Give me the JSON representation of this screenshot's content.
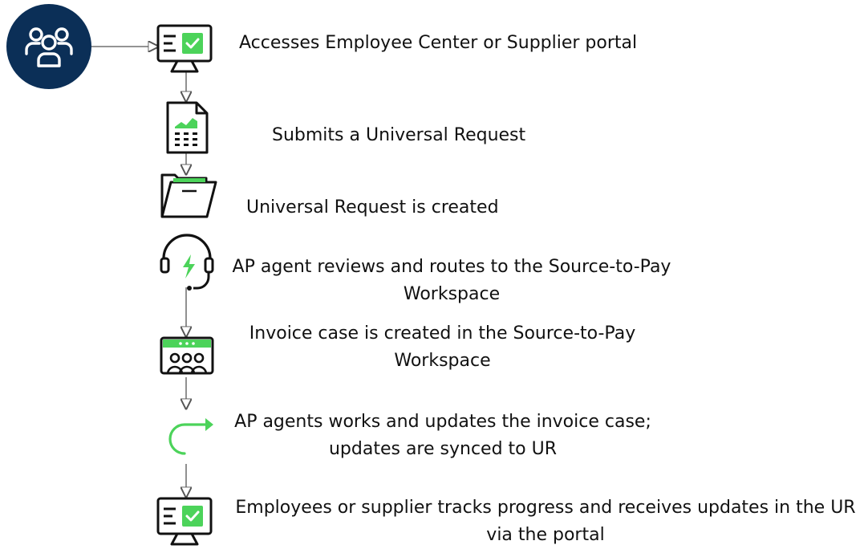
{
  "colors": {
    "accent_green": "#4cd35a",
    "navy": "#0b2f57",
    "ink": "#111111",
    "connector": "#555555"
  },
  "actor": {
    "icon": "people-group-icon"
  },
  "steps": [
    {
      "icon": "monitor-checkmark-icon",
      "lines": [
        "Accesses Employee Center or Supplier portal"
      ]
    },
    {
      "icon": "document-chart-icon",
      "lines": [
        "Submits a Universal Request"
      ]
    },
    {
      "icon": "folder-icon",
      "lines": [
        "Universal Request is created"
      ]
    },
    {
      "icon": "headset-lightning-icon",
      "lines": [
        "AP agent reviews and routes to the Source-to-Pay",
        "Workspace"
      ]
    },
    {
      "icon": "workspace-team-icon",
      "lines": [
        "Invoice case is created in the Source-to-Pay",
        "Workspace"
      ]
    },
    {
      "icon": "curved-arrow-icon",
      "lines": [
        "AP agents works and updates the invoice case;",
        "updates are synced to UR"
      ]
    },
    {
      "icon": "monitor-checkmark-icon",
      "lines": [
        "Employees or supplier tracks progress and receives updates in the UR",
        "via the portal"
      ]
    }
  ]
}
